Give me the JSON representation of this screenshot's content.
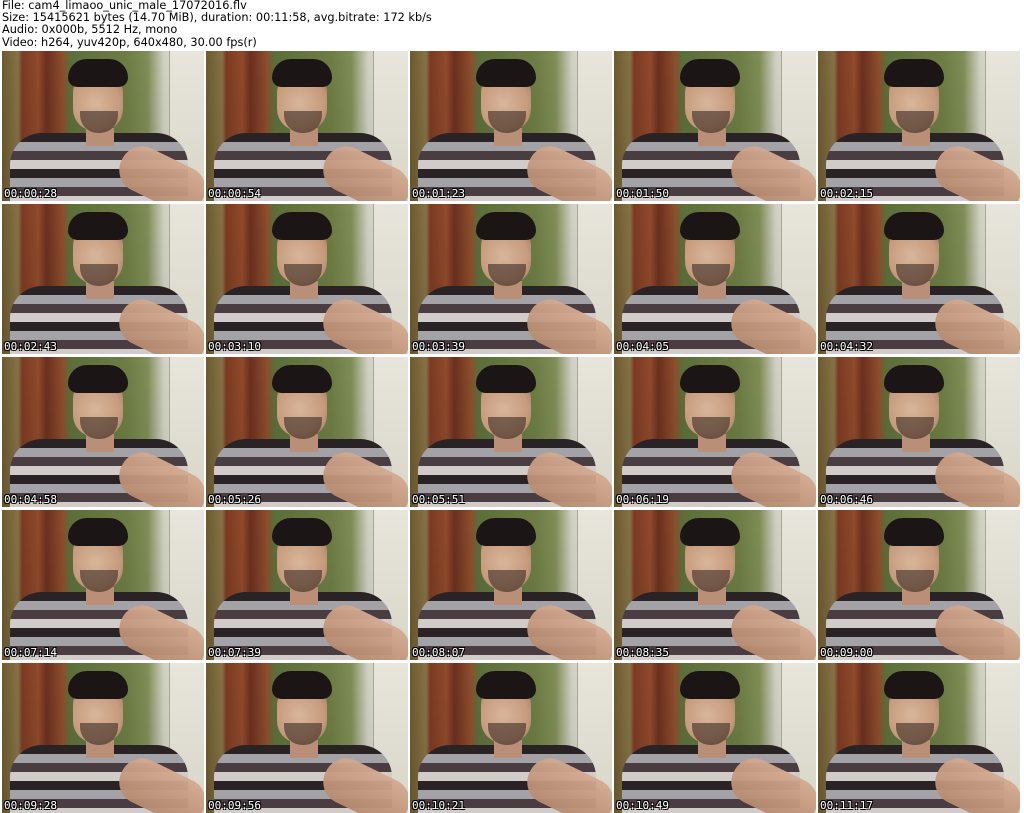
{
  "header": {
    "line1": "File: cam4_limaoo_unic_male_17072016.flv",
    "line2": "Size: 15415621 bytes (14.70 MiB), duration: 00:11:58, avg.bitrate: 172 kb/s",
    "line3": "Audio: 0x000b, 5512 Hz, mono",
    "line4": "Video: h264, yuv420p, 640x480, 30.00 fps(r)"
  },
  "thumbnails": [
    {
      "timestamp": "00:00:28"
    },
    {
      "timestamp": "00:00:54"
    },
    {
      "timestamp": "00:01:23"
    },
    {
      "timestamp": "00:01:50"
    },
    {
      "timestamp": "00:02:15"
    },
    {
      "timestamp": "00:02:43"
    },
    {
      "timestamp": "00:03:10"
    },
    {
      "timestamp": "00:03:39"
    },
    {
      "timestamp": "00:04:05"
    },
    {
      "timestamp": "00:04:32"
    },
    {
      "timestamp": "00:04:58"
    },
    {
      "timestamp": "00:05:26"
    },
    {
      "timestamp": "00:05:51"
    },
    {
      "timestamp": "00:06:19"
    },
    {
      "timestamp": "00:06:46"
    },
    {
      "timestamp": "00:07:14"
    },
    {
      "timestamp": "00:07:39"
    },
    {
      "timestamp": "00:08:07"
    },
    {
      "timestamp": "00:08:35"
    },
    {
      "timestamp": "00:09:00"
    },
    {
      "timestamp": "00:09:28"
    },
    {
      "timestamp": "00:09:56"
    },
    {
      "timestamp": "00:10:21"
    },
    {
      "timestamp": "00:10:49"
    },
    {
      "timestamp": "00:11:17"
    }
  ]
}
